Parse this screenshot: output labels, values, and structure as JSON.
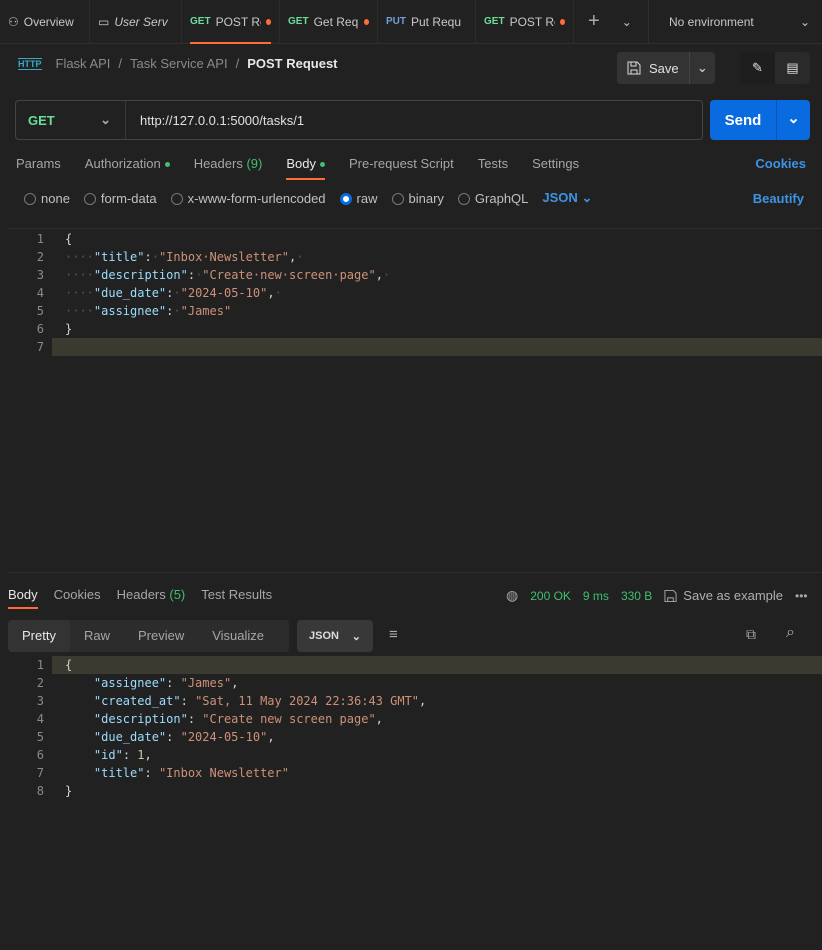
{
  "tabs": [
    {
      "method": "",
      "label": "Overview",
      "icon": "overview-icon"
    },
    {
      "method": "",
      "label": "User Serv",
      "icon": "folder-icon",
      "italic": true
    },
    {
      "method": "GET",
      "label": "POST Re",
      "dot": true,
      "active": true
    },
    {
      "method": "GET",
      "label": "Get Requ",
      "dot": true
    },
    {
      "method": "PUT",
      "label": "Put Requ"
    },
    {
      "method": "GET",
      "label": "POST Re",
      "dot": true
    }
  ],
  "environment": "No environment",
  "breadcrumb": {
    "collection": "Flask API",
    "folder": "Task Service API",
    "request": "POST Request",
    "sep": "/"
  },
  "save_label": "Save",
  "request": {
    "method": "GET",
    "url": "http://127.0.0.1:5000/tasks/1",
    "send_label": "Send"
  },
  "request_tabs": {
    "params": "Params",
    "authorization": "Authorization",
    "headers": "Headers",
    "headers_count": "(9)",
    "body": "Body",
    "pre_request": "Pre-request Script",
    "tests": "Tests",
    "settings": "Settings",
    "cookies": "Cookies"
  },
  "body_types": {
    "none": "none",
    "form_data": "form-data",
    "urlencoded": "x-www-form-urlencoded",
    "raw": "raw",
    "binary": "binary",
    "graphql": "GraphQL",
    "format": "JSON",
    "beautify": "Beautify",
    "selected": "raw"
  },
  "request_body": [
    [
      [
        "p",
        "{"
      ]
    ],
    [
      [
        "w",
        "····"
      ],
      [
        "k",
        "\"title\""
      ],
      [
        "p",
        ":"
      ],
      [
        "w",
        "·"
      ],
      [
        "s",
        "\"Inbox·Newsletter\""
      ],
      [
        "p",
        ","
      ],
      [
        "w",
        "·"
      ]
    ],
    [
      [
        "w",
        "····"
      ],
      [
        "k",
        "\"description\""
      ],
      [
        "p",
        ":"
      ],
      [
        "w",
        "·"
      ],
      [
        "s",
        "\"Create·new·screen·page\""
      ],
      [
        "p",
        ","
      ],
      [
        "w",
        "·"
      ]
    ],
    [
      [
        "w",
        "····"
      ],
      [
        "k",
        "\"due_date\""
      ],
      [
        "p",
        ":"
      ],
      [
        "w",
        "·"
      ],
      [
        "s",
        "\"2024-05-10\""
      ],
      [
        "p",
        ","
      ],
      [
        "w",
        "·"
      ]
    ],
    [
      [
        "w",
        "····"
      ],
      [
        "k",
        "\"assignee\""
      ],
      [
        "p",
        ":"
      ],
      [
        "w",
        "·"
      ],
      [
        "s",
        "\"James\""
      ]
    ],
    [
      [
        "p",
        "}"
      ]
    ],
    []
  ],
  "response_tabs": {
    "body": "Body",
    "cookies": "Cookies",
    "headers": "Headers",
    "headers_count": "(5)",
    "test_results": "Test Results"
  },
  "response_status": {
    "code": "200 OK",
    "time": "9 ms",
    "size": "330 B",
    "save_example": "Save as example"
  },
  "response_views": {
    "pretty": "Pretty",
    "raw": "Raw",
    "preview": "Preview",
    "visualize": "Visualize",
    "format": "JSON"
  },
  "response_body": [
    [
      [
        "p",
        "{"
      ]
    ],
    [
      [
        "p",
        "    "
      ],
      [
        "k",
        "\"assignee\""
      ],
      [
        "p",
        ": "
      ],
      [
        "s",
        "\"James\""
      ],
      [
        "p",
        ","
      ]
    ],
    [
      [
        "p",
        "    "
      ],
      [
        "k",
        "\"created_at\""
      ],
      [
        "p",
        ": "
      ],
      [
        "s",
        "\"Sat, 11 May 2024 22:36:43 GMT\""
      ],
      [
        "p",
        ","
      ]
    ],
    [
      [
        "p",
        "    "
      ],
      [
        "k",
        "\"description\""
      ],
      [
        "p",
        ": "
      ],
      [
        "s",
        "\"Create new screen page\""
      ],
      [
        "p",
        ","
      ]
    ],
    [
      [
        "p",
        "    "
      ],
      [
        "k",
        "\"due_date\""
      ],
      [
        "p",
        ": "
      ],
      [
        "s",
        "\"2024-05-10\""
      ],
      [
        "p",
        ","
      ]
    ],
    [
      [
        "p",
        "    "
      ],
      [
        "k",
        "\"id\""
      ],
      [
        "p",
        ": "
      ],
      [
        "n",
        "1"
      ],
      [
        "p",
        ","
      ]
    ],
    [
      [
        "p",
        "    "
      ],
      [
        "k",
        "\"title\""
      ],
      [
        "p",
        ": "
      ],
      [
        "s",
        "\"Inbox Newsletter\""
      ]
    ],
    [
      [
        "p",
        "}"
      ]
    ]
  ],
  "colors": {
    "accent": "#ff6c37",
    "send": "#0a6be0",
    "get": "#6bdd9a",
    "put": "#6e9fd6",
    "success": "#3fbf6f",
    "link": "#3e93e6"
  }
}
